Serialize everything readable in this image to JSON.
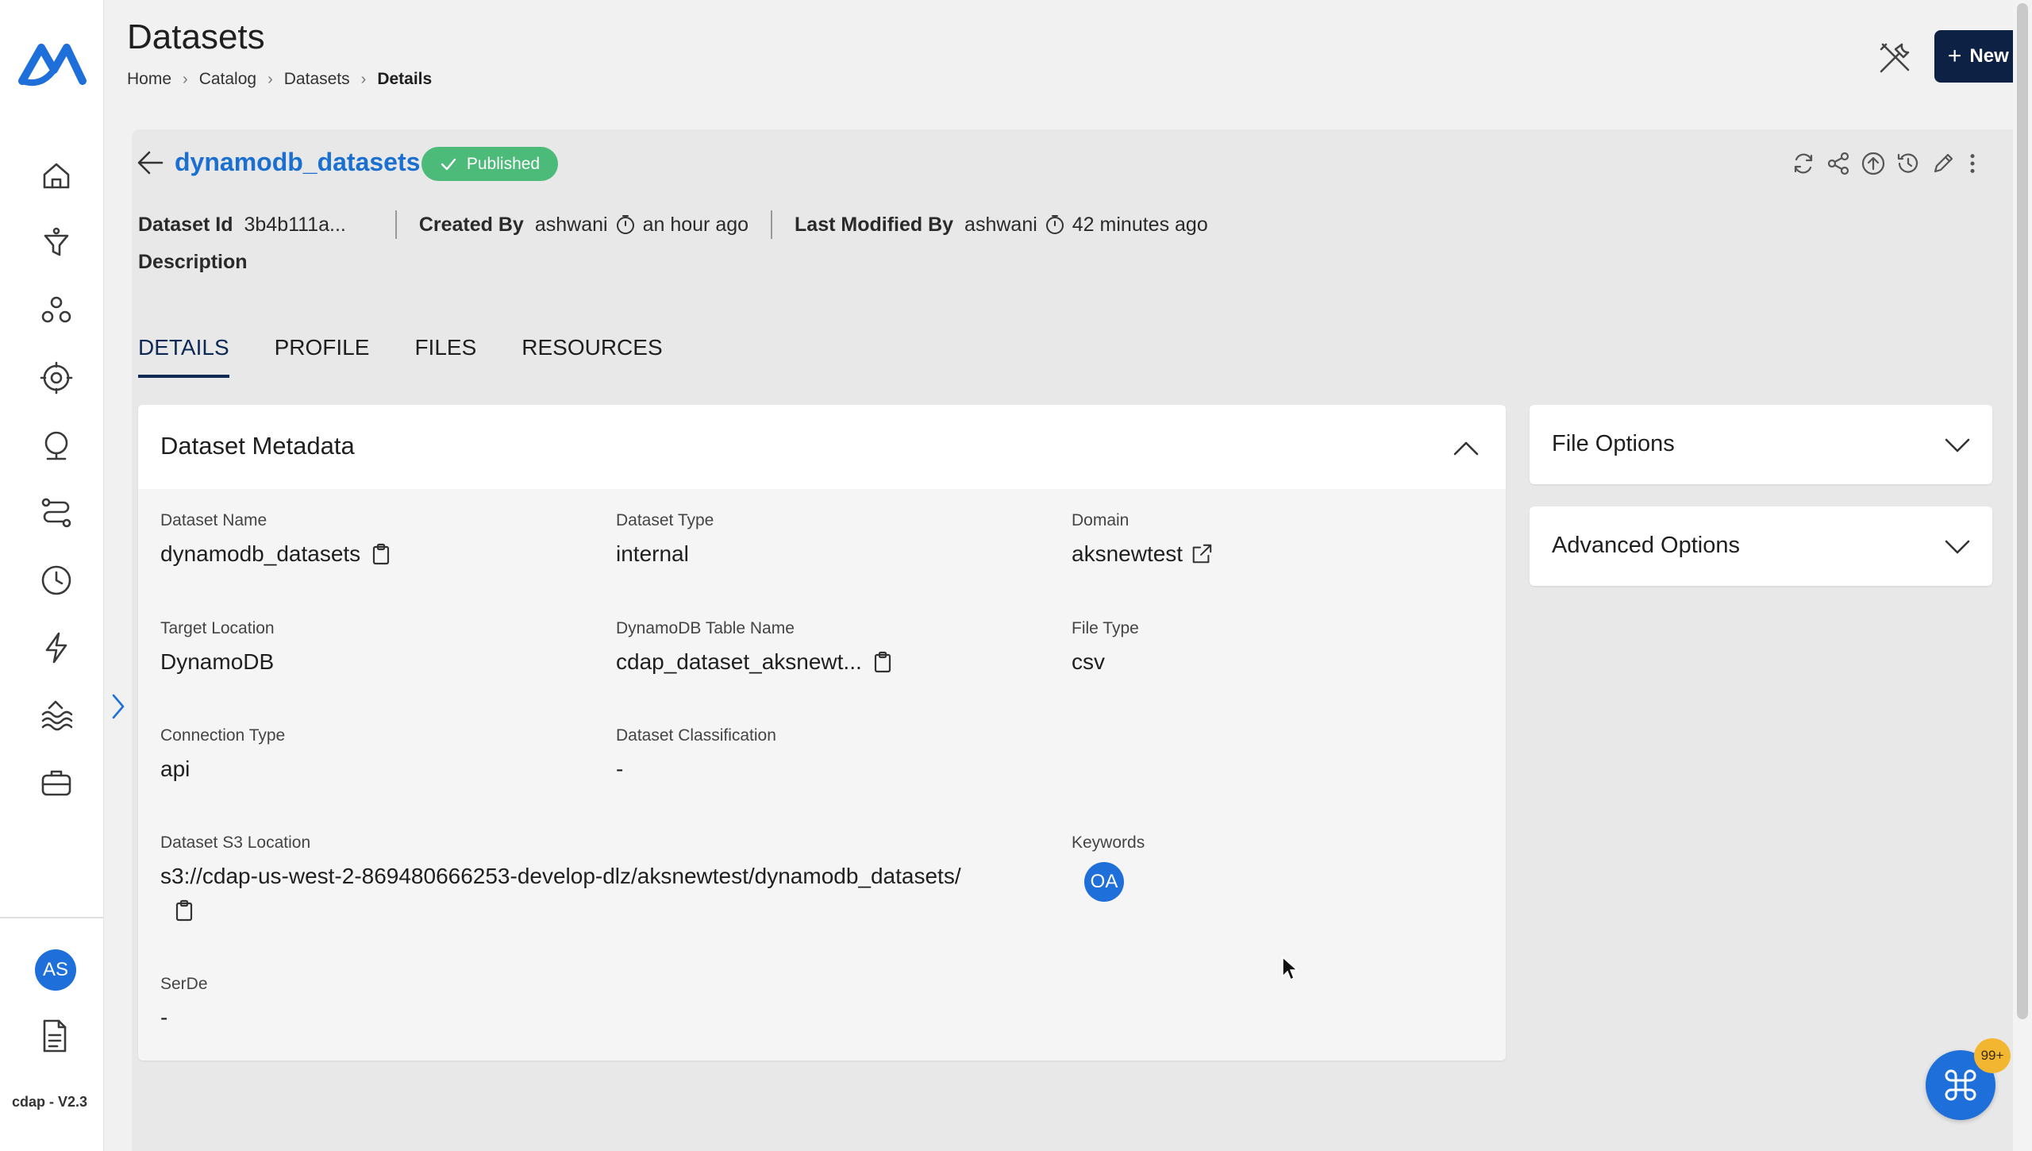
{
  "sidebar": {
    "items": [
      {
        "name": "home-icon"
      },
      {
        "name": "filter-icon"
      },
      {
        "name": "group-icon"
      },
      {
        "name": "settings-icon"
      },
      {
        "name": "globe-icon"
      },
      {
        "name": "pipeline-icon"
      },
      {
        "name": "clock-icon"
      },
      {
        "name": "lightning-icon"
      },
      {
        "name": "lake-icon"
      },
      {
        "name": "briefcase-icon"
      }
    ],
    "avatar_initials": "AS",
    "version": "cdap - V2.3"
  },
  "header": {
    "title": "Datasets",
    "breadcrumb": [
      "Home",
      "Catalog",
      "Datasets",
      "Details"
    ],
    "new_button_label": "New Dataset"
  },
  "dataset": {
    "name": "dynamodb_datasets",
    "status": "Published",
    "status_color": "#4cbb7a",
    "id_label": "Dataset Id",
    "id_value": "3b4b111a...",
    "created_by_label": "Created By",
    "created_by": "ashwani",
    "created_time": "an hour ago",
    "modified_by_label": "Last Modified By",
    "modified_by": "ashwani",
    "modified_time": "42 minutes ago",
    "description_label": "Description"
  },
  "tabs": [
    "DETAILS",
    "PROFILE",
    "FILES",
    "RESOURCES"
  ],
  "active_tab": "DETAILS",
  "metadata": {
    "title": "Dataset Metadata",
    "fields": {
      "dataset_name": {
        "label": "Dataset Name",
        "value": "dynamodb_datasets"
      },
      "dataset_type": {
        "label": "Dataset Type",
        "value": "internal"
      },
      "domain": {
        "label": "Domain",
        "value": "aksnewtest"
      },
      "target_location": {
        "label": "Target Location",
        "value": "DynamoDB"
      },
      "dynamodb_table": {
        "label": "DynamoDB Table Name",
        "value": "cdap_dataset_aksnewt..."
      },
      "file_type": {
        "label": "File Type",
        "value": "csv"
      },
      "connection_type": {
        "label": "Connection Type",
        "value": "api"
      },
      "classification": {
        "label": "Dataset Classification",
        "value": "-"
      },
      "s3_location": {
        "label": "Dataset S3 Location",
        "value": "s3://cdap-us-west-2-869480666253-develop-dlz/aksnewtest/dynamodb_datasets/"
      },
      "keywords": {
        "label": "Keywords",
        "chip": "OA"
      },
      "serde": {
        "label": "SerDe",
        "value": "-"
      }
    }
  },
  "side_panels": {
    "file_options": "File Options",
    "advanced_options": "Advanced Options"
  },
  "fab_badge": "99+",
  "colors": {
    "accent_blue": "#1a6fd1",
    "primary_dark": "#0d2145",
    "badge_yellow": "#f2b630"
  }
}
